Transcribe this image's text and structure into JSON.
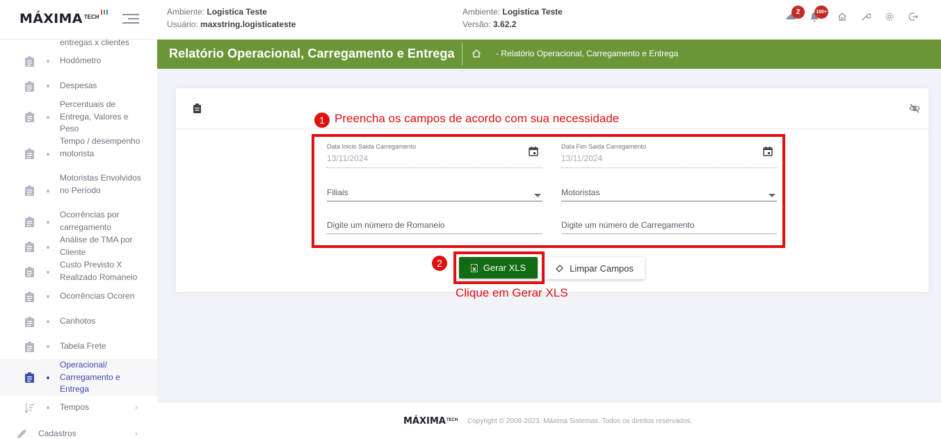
{
  "header": {
    "logo_main": "MÁXIMA",
    "logo_tech": "TECH",
    "env_label": "Ambiente:",
    "env_value": "Logistica Teste",
    "user_label": "Usuário:",
    "user_value": "maxstring.logisticateste",
    "env2_label": "Ambiente:",
    "env2_value": "Logistica Teste",
    "version_label": "Versão:",
    "version_value": "3.62.2",
    "badge_truck": "2",
    "badge_bell": "100+",
    "brand_colors": [
      "#e94b3c",
      "#62a03c",
      "#3d7ad3"
    ]
  },
  "sidebar": {
    "items": [
      {
        "label": "entregas x clientes",
        "icon": "minus-icon"
      },
      {
        "label": "Hodômetro",
        "icon": "clipboard-icon"
      },
      {
        "label": "Despesas",
        "icon": "clipboard-icon"
      },
      {
        "label": "Percentuais de Entrega, Valores e Peso",
        "icon": "clipboard-icon"
      },
      {
        "label": "Tempo / desempenho motorista",
        "icon": "clipboard-icon"
      },
      {
        "label": "Motoristas Envolvidos no Período",
        "icon": "clipboard-icon"
      },
      {
        "label": "Ocorrências por carregamento",
        "icon": "clipboard-icon"
      },
      {
        "label": "Análise de TMA por Cliente",
        "icon": "clipboard-icon"
      },
      {
        "label": "Custo Previsto X Realizado Romaneio",
        "icon": "clipboard-icon"
      },
      {
        "label": "Ocorrências Ocoren",
        "icon": "clipboard-icon"
      },
      {
        "label": "Canhotos",
        "icon": "clipboard-icon"
      },
      {
        "label": "Tabela Frete",
        "icon": "clipboard-icon"
      },
      {
        "label": "Operacional/ Carregamento e Entrega",
        "icon": "clipboard-icon"
      },
      {
        "label": "Tempos",
        "icon": "sort-icon"
      },
      {
        "label": "Cadastros",
        "icon": "pencil-icon"
      }
    ]
  },
  "subheader": {
    "title": "Relatório Operacional, Carregamento e Entrega",
    "breadcrumb": "- Relatório Operacional, Carregamento e Entrega",
    "color": "#6a9638"
  },
  "form": {
    "date_start_label": "Data Inicio Saida Carregamento",
    "date_start_value": "13/11/2024",
    "date_end_label": "Data Fim Saida Carregamento",
    "date_end_value": "13/11/2024",
    "filiais_placeholder": "Filiais",
    "motoristas_placeholder": "Motoristas",
    "romaneio_placeholder": "Digite um número de Romaneio",
    "carregamento_placeholder": "Digite um número de Carregamento",
    "gerar_label": "Gerar XLS",
    "limpar_label": "Limpar Campos"
  },
  "annotations": {
    "num1": "1",
    "text1": "Preencha os campos de acordo com sua necessidade",
    "num2": "2",
    "text2": "Clique em Gerar XLS",
    "color": "#e01010"
  },
  "footer": {
    "logo_main": "MÁXIMA",
    "logo_tech": "TECH",
    "copyright": "Copyright © 2008-2023. Máxima Sistemas. Todos os direitos reservados."
  }
}
